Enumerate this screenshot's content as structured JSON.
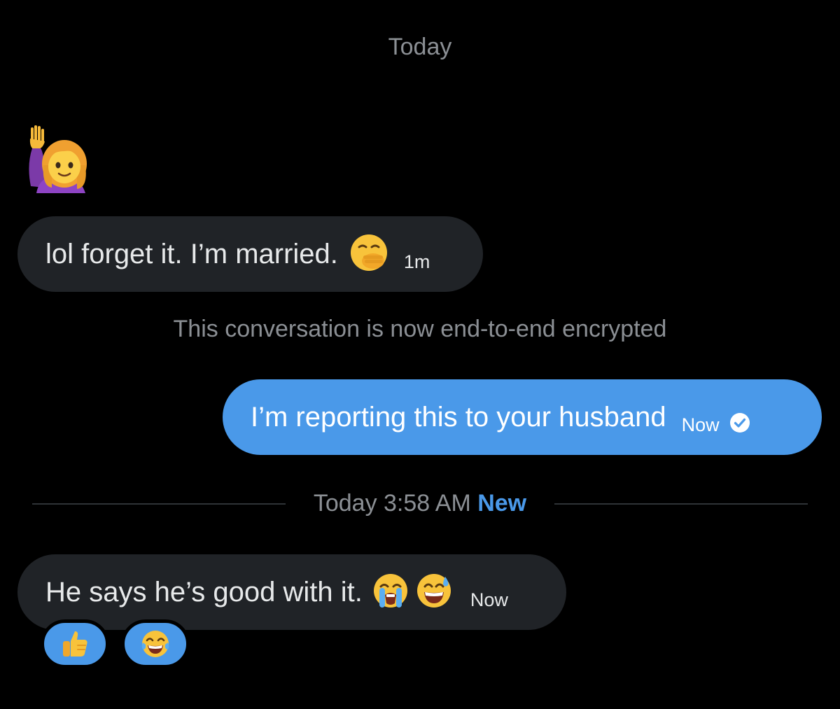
{
  "conversation": {
    "date_header": "Today",
    "messages": [
      {
        "direction": "received",
        "text": "lol forget it. I’m married.",
        "emojis": [
          "face-with-hand-over-mouth"
        ],
        "time": "1m"
      },
      {
        "direction": "sent",
        "text": "I’m reporting this to your husband",
        "time": "Now",
        "status_icon": "check-circle-icon"
      },
      {
        "direction": "received",
        "text": "He says he’s good with it.",
        "emojis": [
          "loudly-crying-face",
          "grinning-face-with-sweat"
        ],
        "time": "Now",
        "reactions": [
          "thumbs-up",
          "face-with-tears-of-joy"
        ]
      }
    ],
    "sticker": "woman-raising-hand",
    "system_note": "This conversation is now end-to-end encrypted",
    "divider": {
      "time_text": "Today 3:58 AM",
      "new_label": "New"
    }
  },
  "colors": {
    "background": "#000000",
    "received_bubble": "#202327",
    "sent_bubble": "#4a99e9",
    "muted_text": "#8b8f94",
    "accent": "#4a99e9"
  }
}
